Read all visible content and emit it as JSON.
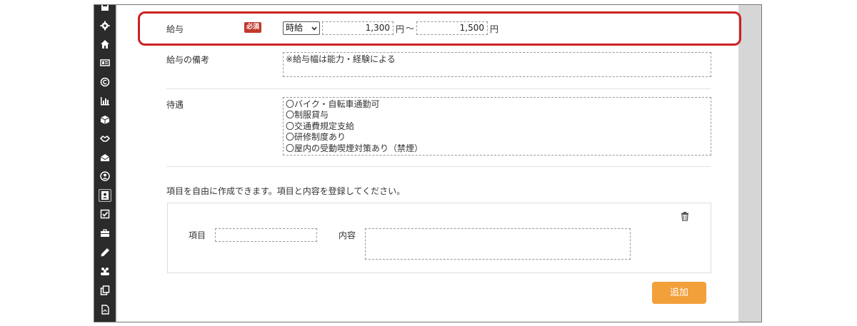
{
  "sidebar": {
    "icons": [
      "save-icon",
      "gear-icon",
      "home-icon",
      "id-card-icon",
      "copyright-icon",
      "chart-icon",
      "cube-icon",
      "handshake-icon",
      "envelope-icon",
      "user-circle-icon",
      "address-book-icon",
      "checkbox-icon",
      "briefcase-icon",
      "pencil-icon",
      "group-icon",
      "copy-icon",
      "pdf-icon"
    ],
    "active_index": 10
  },
  "salary": {
    "label": "給与",
    "required_badge": "必須",
    "type_selected": "時給",
    "min_value": "1,300",
    "max_value": "1,500",
    "unit": "円",
    "range_sep": "〜"
  },
  "salary_note": {
    "label": "給与の備考",
    "value": "※給与幅は能力・経験による"
  },
  "benefits": {
    "label": "待遇",
    "lines": [
      "〇バイク・自転車通勤可",
      "〇制服貸与",
      "〇交通費規定支給",
      "〇研修制度あり",
      "〇屋内の受動喫煙対策あり（禁煙）"
    ]
  },
  "custom": {
    "instruction": "項目を自由に作成できます。項目と内容を登録してください。",
    "item_label": "項目",
    "content_label": "内容",
    "item_value": "",
    "content_value": "",
    "add_button": "追加"
  },
  "colors": {
    "accent_orange": "#f2a03a",
    "required_red": "#c0392b",
    "highlight_red": "#cc2222",
    "sidebar_dark": "#2b2b2b"
  }
}
